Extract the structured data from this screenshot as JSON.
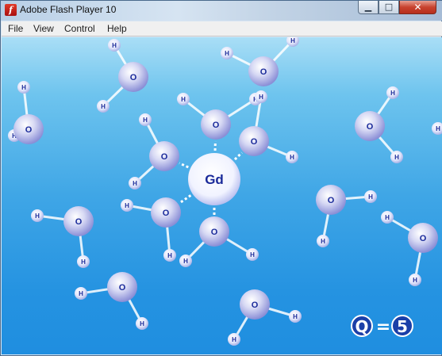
{
  "window": {
    "title": "Adobe Flash Player 10",
    "app_icon": "flash-player-icon",
    "controls": {
      "minimize_icon": "minimize-icon",
      "maximize_icon": "maximize-icon",
      "close_icon": "close-icon"
    }
  },
  "menu": {
    "items": [
      "File",
      "View",
      "Control",
      "Help"
    ]
  },
  "animation": {
    "center_label": "Gd",
    "oxygen_label": "O",
    "hydrogen_label": "H",
    "q_letter": "Q",
    "q_equals": "=",
    "q_value": "5",
    "colors": {
      "stage_top": "#a9def6",
      "stage_bottom": "#1f8ee0",
      "atom_text": "#1a2a9a",
      "q_badge": "#1b3fa8"
    }
  }
}
